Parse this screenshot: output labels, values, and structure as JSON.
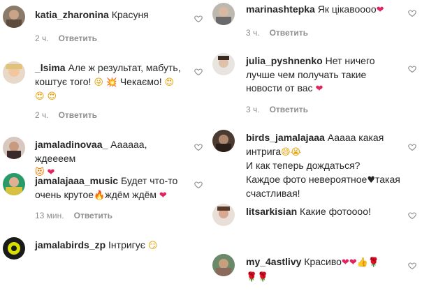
{
  "left": [
    {
      "username": "katia_zharonina",
      "text": "Красуня",
      "emoji": "",
      "time": "2 ч.",
      "reply": "Ответить"
    },
    {
      "username": "_lsima",
      "text": "Але ж результат, мабуть, коштує того!",
      "text2": "Чекаємо!",
      "emoji": "",
      "time": "2 ч.",
      "reply": "Ответить"
    },
    {
      "username": "jamaladinovaa_",
      "text": "Аааааа, ждеееем",
      "emoji": "",
      "time": "",
      "reply": ""
    },
    {
      "username": "jamalajaaa_music",
      "text": "Будет что-то очень крутое",
      "text2": "ждём ждём",
      "emoji": "",
      "time": "13 мин.",
      "reply": "Ответить"
    },
    {
      "username": "jamalabirds_zp",
      "text": "Інтригує",
      "emoji": "",
      "time": "",
      "reply": ""
    }
  ],
  "right": [
    {
      "username": "marinashtepka",
      "text": "Як цікавоооо",
      "emoji": "",
      "time": "3 ч.",
      "reply": "Ответить"
    },
    {
      "username": "julia_pyshnenko",
      "text": "Нет ничего лучше чем получать такие новости от вас",
      "emoji": "",
      "time": "3 ч.",
      "reply": "Ответить"
    },
    {
      "username": "birds_jamalajaaa",
      "text": "Ааааа какая интрига",
      "text2": "И как теперь дождаться?",
      "text3": "Каждое фото невероятное",
      "text4": "такая счастливая!",
      "emoji": "",
      "time": "",
      "reply": ""
    },
    {
      "username": "litsarkisian",
      "text": "Какие фотоооо!",
      "emoji": "",
      "time": "",
      "reply": ""
    },
    {
      "username": "my_4astlivy",
      "text": "Красиво",
      "emoji": "",
      "time": "",
      "reply": ""
    }
  ],
  "colors": {
    "text": "#262626",
    "meta": "#8e8e8e",
    "heart_emoji": "#e0245e"
  },
  "icons": {
    "like": "heart-outline-icon"
  }
}
